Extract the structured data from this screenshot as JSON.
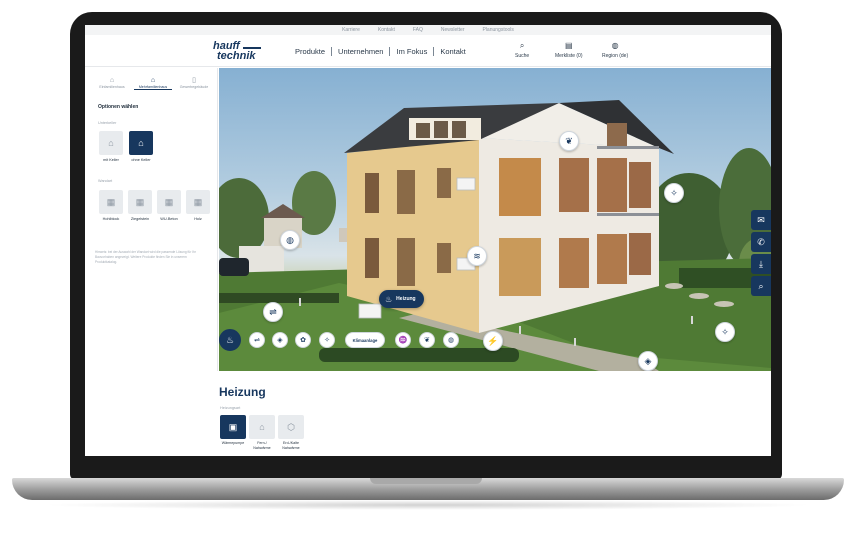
{
  "topbar": {
    "links": [
      "Karriere",
      "Kontakt",
      "FAQ",
      "Newsletter",
      "Planungstools"
    ]
  },
  "header": {
    "logo": {
      "line1": "hauff",
      "line2": "technik"
    },
    "nav": [
      "Produkte",
      "Unternehmen",
      "Im Fokus",
      "Kontakt"
    ],
    "tools": [
      {
        "icon": "search-icon",
        "label": "Suche"
      },
      {
        "icon": "notepad-icon",
        "label": "Merkliste (0)"
      },
      {
        "icon": "globe-icon",
        "label": "Region (de)"
      }
    ]
  },
  "sidebar": {
    "building_types": [
      {
        "label": "Einfamilienhaus",
        "icon": "house-icon",
        "active": false
      },
      {
        "label": "Mehrfamilienhaus",
        "icon": "apartment-house-icon",
        "active": true
      },
      {
        "label": "Gewerbegebäude",
        "icon": "commercial-building-icon",
        "active": false
      }
    ],
    "title": "Optionen wählen",
    "basement": {
      "label": "Unterkeller",
      "options": [
        {
          "label": "mit Keller",
          "icon": "house-with-cellar-icon",
          "active": false
        },
        {
          "label": "ohne Keller",
          "icon": "house-icon",
          "active": true
        }
      ]
    },
    "walls": {
      "label": "Wandart",
      "options": [
        {
          "label": "Hohlblock",
          "icon": "hollow-block-icon"
        },
        {
          "label": "Ziegelstein",
          "icon": "brick-icon"
        },
        {
          "label": "WU-Beton",
          "icon": "concrete-icon"
        },
        {
          "label": "Holz",
          "icon": "wood-icon"
        }
      ]
    },
    "note": "Hinweis: bei der Auswahl der Wandart wird die passende Lösung für Ihr Bauvorhaben angezeigt. Weitere Produkte finden Sie in unserem Produktkatalog."
  },
  "scene": {
    "active_label": "Heizung",
    "hotspots": [
      "leaf-icon",
      "satellite-icon",
      "globe-icon",
      "air-icon",
      "car-icon",
      "electricity-icon",
      "gas-icon"
    ],
    "hotbar": [
      {
        "icon": "heating-icon",
        "label": ""
      },
      {
        "icon": "car-icon",
        "label": ""
      },
      {
        "icon": "gas-icon",
        "label": ""
      },
      {
        "icon": "plant-icon",
        "label": ""
      },
      {
        "icon": "satellite-icon",
        "label": ""
      },
      {
        "icon": "",
        "label": "Klimaanlage"
      },
      {
        "icon": "water-icon",
        "label": ""
      },
      {
        "icon": "leaf-icon",
        "label": ""
      },
      {
        "icon": "globe-icon",
        "label": ""
      }
    ],
    "side_tools": [
      "mail-icon",
      "phone-icon",
      "download-icon",
      "zoom-icon"
    ]
  },
  "detail": {
    "title": "Heizung",
    "sub_label": "Heizungsart",
    "options": [
      {
        "label": "Wärmepumpe",
        "icon": "heat-pump-icon",
        "active": true
      },
      {
        "label": "Fern-/ Nahwärme",
        "icon": "district-heating-icon",
        "active": false
      },
      {
        "label": "Erd-/Kalte Nahwärme",
        "icon": "geothermal-icon",
        "active": false
      }
    ]
  },
  "colors": {
    "brand": "#17375e",
    "panel_bg": "#e8ebee"
  }
}
